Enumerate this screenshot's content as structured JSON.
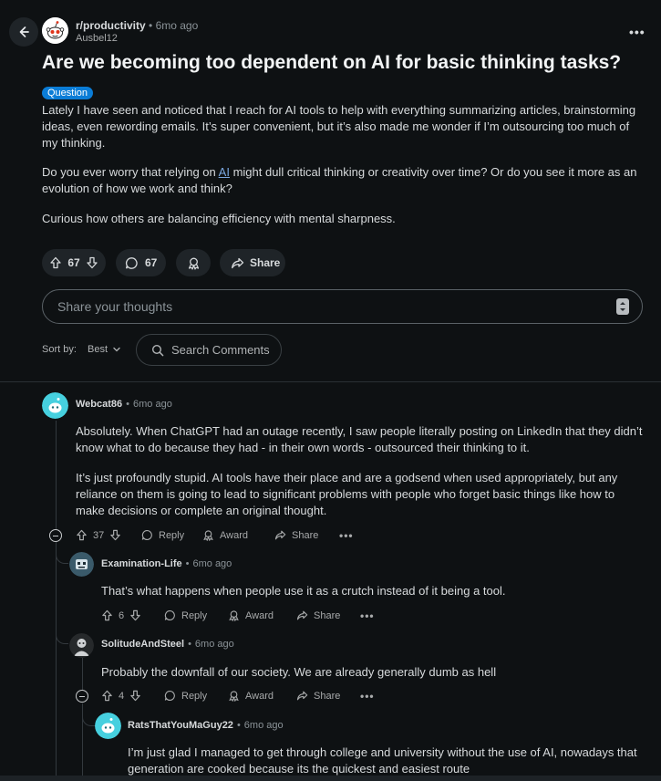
{
  "post": {
    "subreddit": "r/productivity",
    "time": "6mo ago",
    "author": "Ausbel12",
    "title": "Are we becoming too dependent on AI for basic thinking tasks?",
    "flair": "Question",
    "paragraph1": "Lately I have seen and noticed that I reach for AI tools to help with everything summarizing articles, brainstorming ideas, even rewording emails. It’s super convenient, but it’s also made me wonder if I’m outsourcing too much of my thinking.",
    "paragraph2_before": "Do you ever worry that relying on ",
    "paragraph2_link": "AI",
    "paragraph2_after": " might dull critical thinking or creativity over time? Or do you see it more as an evolution of how we work and think?",
    "paragraph3": "Curious how others are balancing efficiency with mental sharpness.",
    "votes": "67",
    "comments": "67",
    "share_label": "Share"
  },
  "composer": {
    "placeholder": "Share your thoughts"
  },
  "sort": {
    "label": "Sort by:",
    "value": "Best",
    "search_label": "Search Comments"
  },
  "comments": [
    {
      "user": "Webcat86",
      "time": "6mo ago",
      "text1": "Absolutely. When ChatGPT had an outage recently, I saw people literally posting on LinkedIn that they didn’t know what to do because they had - in their own words - outsourced their thinking to it.",
      "text2": "It’s just profoundly stupid. AI tools have their place and are a godsend when used appropriately, but any reliance on them is going to lead to significant problems with people who forget basic things like how to make decisions or complete an original thought.",
      "votes": "37",
      "reply": "Reply",
      "award": "Award",
      "share": "Share"
    },
    {
      "user": "Examination-Life",
      "time": "6mo ago",
      "text": "That’s what happens when people use it as a crutch instead of it being a tool.",
      "votes": "6",
      "reply": "Reply",
      "award": "Award",
      "share": "Share"
    },
    {
      "user": "SolitudeAndSteel",
      "time": "6mo ago",
      "text": "Probably the downfall of our society. We are already generally dumb as hell",
      "votes": "4",
      "reply": "Reply",
      "award": "Award",
      "share": "Share"
    },
    {
      "user": "RatsThatYouMaGuy22",
      "time": "6mo ago",
      "text": "I’m just glad I managed to get through college and university without the use of AI, nowadays that generation are cooked because its the quickest and easiest route"
    }
  ],
  "colors": {
    "background": "#0e1113",
    "flair": "#0a7cd6",
    "link": "#7aa7e0",
    "avatar_teal": "#3ec8d8"
  },
  "icons": [
    "back-arrow-icon",
    "snoo-icon",
    "more-options-icon",
    "upvote-icon",
    "downvote-icon",
    "comment-icon",
    "award-icon",
    "share-icon",
    "search-icon",
    "chevron-down-icon",
    "collapse-icon",
    "reply-icon"
  ]
}
